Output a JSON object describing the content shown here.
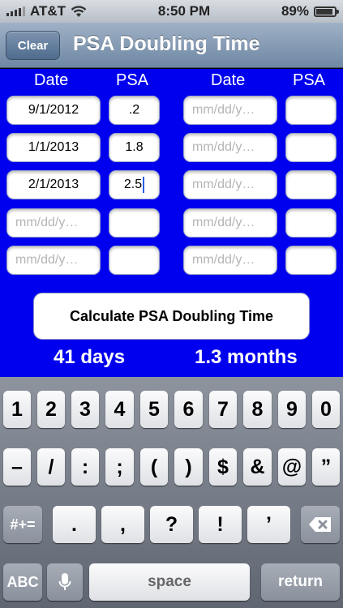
{
  "status_bar": {
    "carrier": "AT&T",
    "time": "8:50 PM",
    "battery": "89%",
    "battery_level": 0.89
  },
  "nav": {
    "clear_label": "Clear",
    "title": "PSA Doubling Time"
  },
  "table": {
    "date_header": "Date",
    "psa_header": "PSA",
    "date_placeholder": "mm/dd/y…",
    "left_rows": [
      {
        "date": "9/1/2012",
        "psa": ".2"
      },
      {
        "date": "1/1/2013",
        "psa": "1.8"
      },
      {
        "date": "2/1/2013",
        "psa": "2.5"
      },
      {
        "date": "",
        "psa": ""
      },
      {
        "date": "",
        "psa": ""
      }
    ],
    "right_rows": [
      {
        "date": "",
        "psa": ""
      },
      {
        "date": "",
        "psa": ""
      },
      {
        "date": "",
        "psa": ""
      },
      {
        "date": "",
        "psa": ""
      },
      {
        "date": "",
        "psa": ""
      }
    ]
  },
  "calculate_label": "Calculate PSA Doubling Time",
  "results": {
    "days": "41 days",
    "months": "1.3 months"
  },
  "keyboard": {
    "row1": [
      "1",
      "2",
      "3",
      "4",
      "5",
      "6",
      "7",
      "8",
      "9",
      "0"
    ],
    "row2": [
      "–",
      "/",
      ":",
      ";",
      "(",
      ")",
      "$",
      "&",
      "@",
      "”"
    ],
    "row3": [
      ".",
      ",",
      "?",
      "!",
      "’"
    ],
    "symbols_label": "#+=",
    "abc_label": "ABC",
    "space_label": "space",
    "return_label": "return",
    "delete_icon": "backspace-icon",
    "mic_icon": "microphone-icon"
  }
}
